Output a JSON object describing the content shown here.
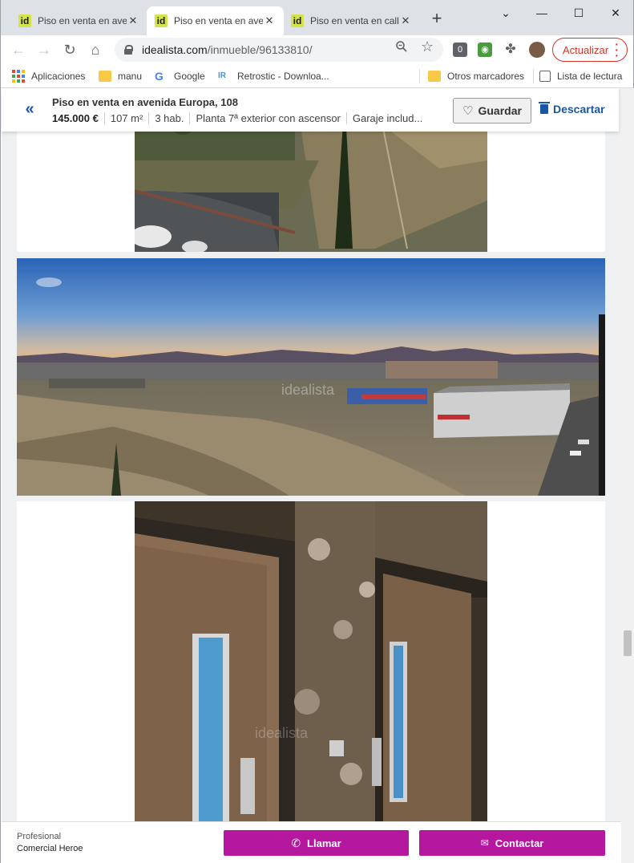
{
  "tabs": [
    {
      "title": "Piso en venta en aven",
      "favicon": "id"
    },
    {
      "title": "Piso en venta en aven",
      "favicon": "id"
    },
    {
      "title": "Piso en venta en call",
      "favicon": "id"
    }
  ],
  "address_bar": {
    "host": "idealista.com",
    "path": "/inmueble/96133810/"
  },
  "toolbar": {
    "update_label": "Actualizar"
  },
  "bookmarks": [
    {
      "label": "Aplicaciones",
      "icon": "apps-grid-icon"
    },
    {
      "label": "manu",
      "icon": "folder-icon"
    },
    {
      "label": "Google",
      "icon": "google-icon"
    },
    {
      "label": "Retrostic - Downloa...",
      "icon": "retrostic-icon"
    },
    {
      "label": "Otros marcadores",
      "icon": "folder-icon"
    },
    {
      "label": "Lista de lectura",
      "icon": "reading-list-icon"
    }
  ],
  "listing": {
    "title": "Piso en venta en avenida Europa, 108",
    "price": "145.000 €",
    "details": [
      "107 m²",
      "3 hab.",
      "Planta 7ª exterior con ascensor",
      "Garaje includ..."
    ],
    "save_label": "Guardar",
    "discard_label": "Descartar"
  },
  "footer": {
    "advertiser_type": "Profesional",
    "advertiser_name": "Comercial Heroe",
    "call_label": "Llamar",
    "contact_label": "Contactar"
  },
  "photos": [
    {
      "name": "photo-garden-view",
      "watermark": ""
    },
    {
      "name": "photo-panorama",
      "watermark": "idealista"
    },
    {
      "name": "photo-elevators",
      "watermark": "idealista"
    }
  ]
}
